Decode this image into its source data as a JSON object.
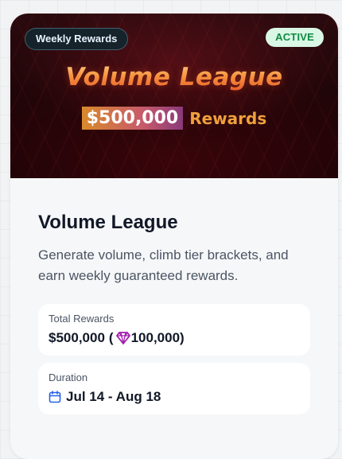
{
  "banner": {
    "tag_weekly": "Weekly Rewards",
    "tag_active": "ACTIVE",
    "art_title": "Volume League",
    "art_amount": "$500,000",
    "art_rewards": "Rewards"
  },
  "details": {
    "title": "Volume League",
    "description": "Generate volume, climb tier brackets, and earn weekly guaranteed rewards."
  },
  "total_rewards": {
    "label": "Total Rewards",
    "amount": "$500,000",
    "open_paren": "(",
    "gem_icon": "gem-icon",
    "gem_amount": "100,000)"
  },
  "duration": {
    "label": "Duration",
    "icon": "calendar-icon",
    "value": "Jul 14 - Aug 18"
  },
  "colors": {
    "active_text": "#0f8a43",
    "active_bg": "#d9f7e4",
    "gem": "#a21caf",
    "calendar": "#2563eb"
  }
}
